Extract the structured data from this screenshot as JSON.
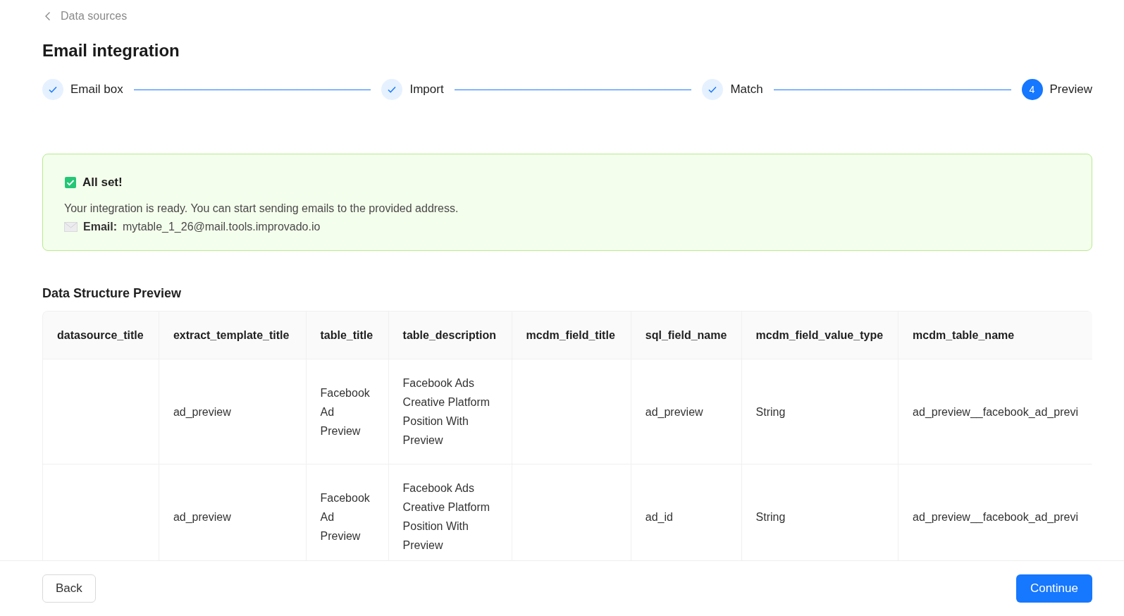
{
  "breadcrumb": {
    "label": "Data sources"
  },
  "title": "Email integration",
  "steps": [
    {
      "label": "Email box",
      "completed": true
    },
    {
      "label": "Import",
      "completed": true
    },
    {
      "label": "Match",
      "completed": true
    },
    {
      "label": "Preview",
      "completed": false,
      "number": "4"
    }
  ],
  "alert": {
    "title": "All set!",
    "message": "Your integration is ready. You can start sending emails to the provided address.",
    "email_label": "Email:",
    "email": "mytable_1_26@mail.tools.improvado.io"
  },
  "preview": {
    "heading": "Data Structure Preview",
    "columns": [
      "datasource_title",
      "extract_template_title",
      "table_title",
      "table_description",
      "mcdm_field_title",
      "sql_field_name",
      "mcdm_field_value_type",
      "mcdm_table_name"
    ],
    "rows": [
      [
        "",
        "ad_preview",
        "Facebook Ad Preview",
        "Facebook Ads Creative Platform Position With Preview",
        "",
        "ad_preview",
        "String",
        "ad_preview__facebook_ad_previ"
      ],
      [
        "",
        "ad_preview",
        "Facebook Ad Preview",
        "Facebook Ads Creative Platform Position With Preview",
        "",
        "ad_id",
        "String",
        "ad_preview__facebook_ad_previ"
      ]
    ]
  },
  "footer": {
    "back": "Back",
    "continue": "Continue"
  }
}
